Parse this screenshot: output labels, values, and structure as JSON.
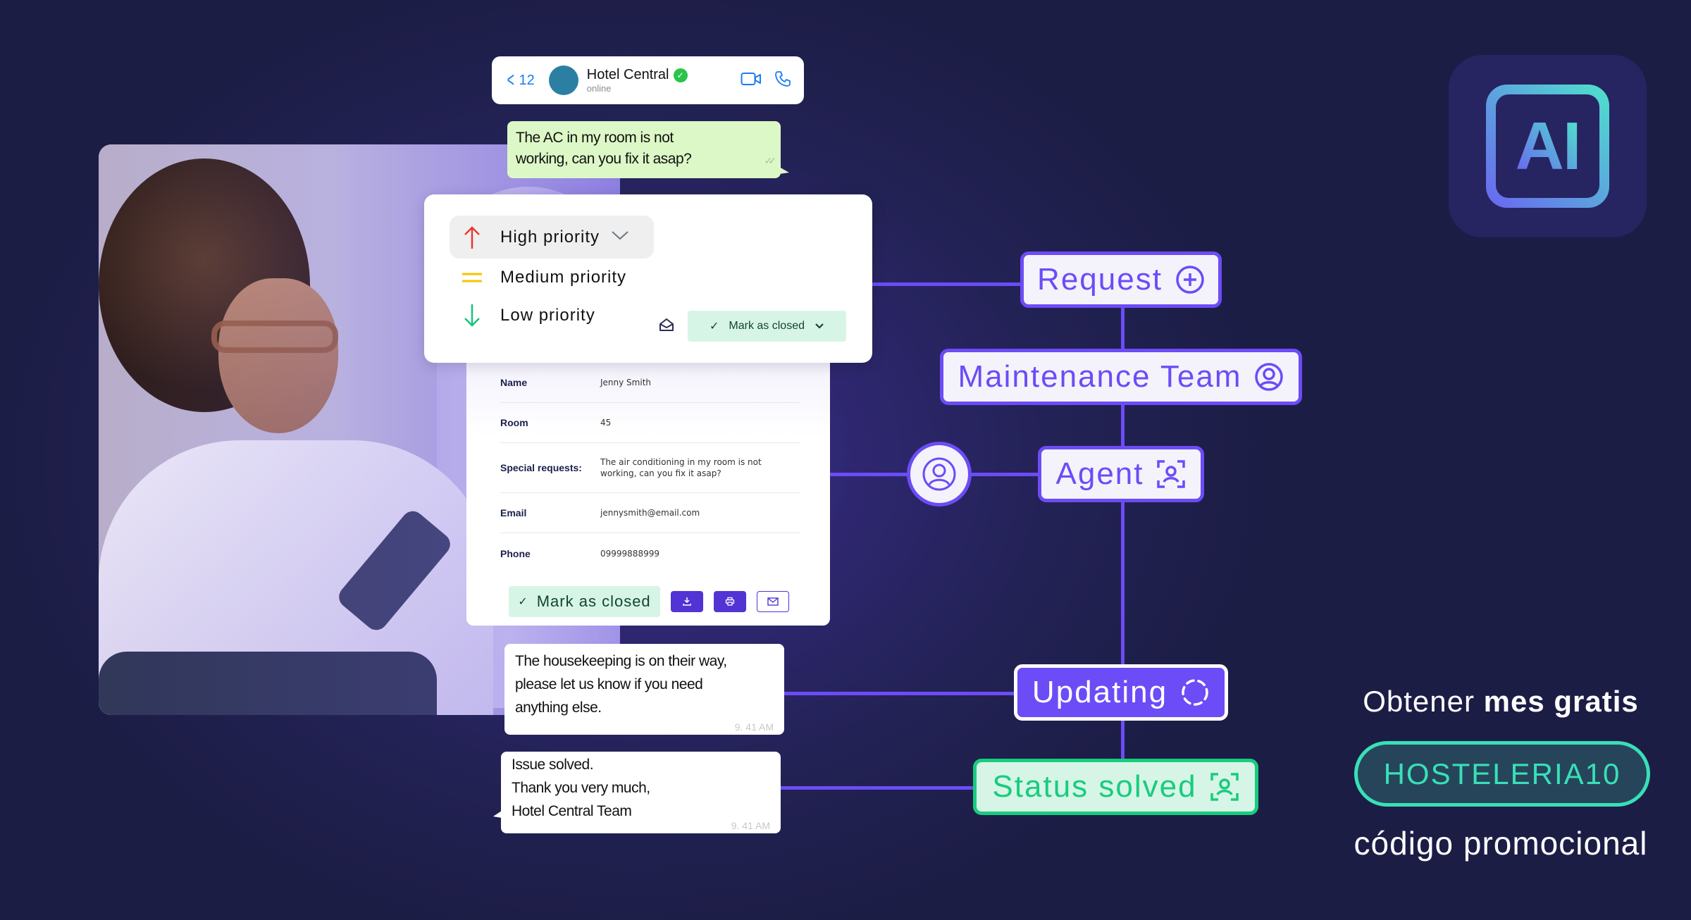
{
  "chat": {
    "back_count": "12",
    "contact_name": "Hotel Central",
    "status": "online",
    "messages": {
      "guest": "The AC in my room is not working, can you fix it asap?",
      "guest_line1": "The AC in my room is not",
      "guest_line2": "working, can you fix it asap?",
      "reply1_line1": "The housekeeping is on their way,",
      "reply1_line2": "please let us know if you need",
      "reply1_line3": "anything else.",
      "reply1_time": "9. 41 AM",
      "reply2_line1": "Issue solved.",
      "reply2_line2": "Thank you very much,",
      "reply2_line3": "Hotel Central Team",
      "reply2_time": "9. 41 AM"
    }
  },
  "priority": {
    "options": [
      {
        "label": "High priority",
        "icon": "arrow-up-icon",
        "color": "#e53935",
        "selected": true
      },
      {
        "label": "Medium priority",
        "icon": "equals-icon",
        "color": "#f5c400"
      },
      {
        "label": "Low priority",
        "icon": "arrow-down-icon",
        "color": "#19c37d"
      }
    ],
    "mark_closed_label": "Mark as closed"
  },
  "details": {
    "rows": [
      {
        "label": "Name",
        "value": "Jenny Smith"
      },
      {
        "label": "Room",
        "value": "45"
      },
      {
        "label": "Special requests:",
        "value": "The air conditioning in my room is not working, can you fix it asap?"
      },
      {
        "label": "Email",
        "value": "jennysmith@email.com"
      },
      {
        "label": "Phone",
        "value": "09999888999"
      }
    ],
    "mark_closed_label": "Mark as closed"
  },
  "workflow": {
    "request": "Request",
    "maintenance": "Maintenance Team",
    "agent": "Agent",
    "updating": "Updating",
    "solved": "Status solved"
  },
  "logo": {
    "text": "AI"
  },
  "promo": {
    "lead": "Obtener",
    "lead_bold": "mes gratis",
    "code": "HOSTELERIA10",
    "caption": "código promocional"
  },
  "colors": {
    "background": "#1c1d45",
    "accent": "#6c4cf7",
    "success": "#18cc7e",
    "promo": "#38e0b8"
  }
}
